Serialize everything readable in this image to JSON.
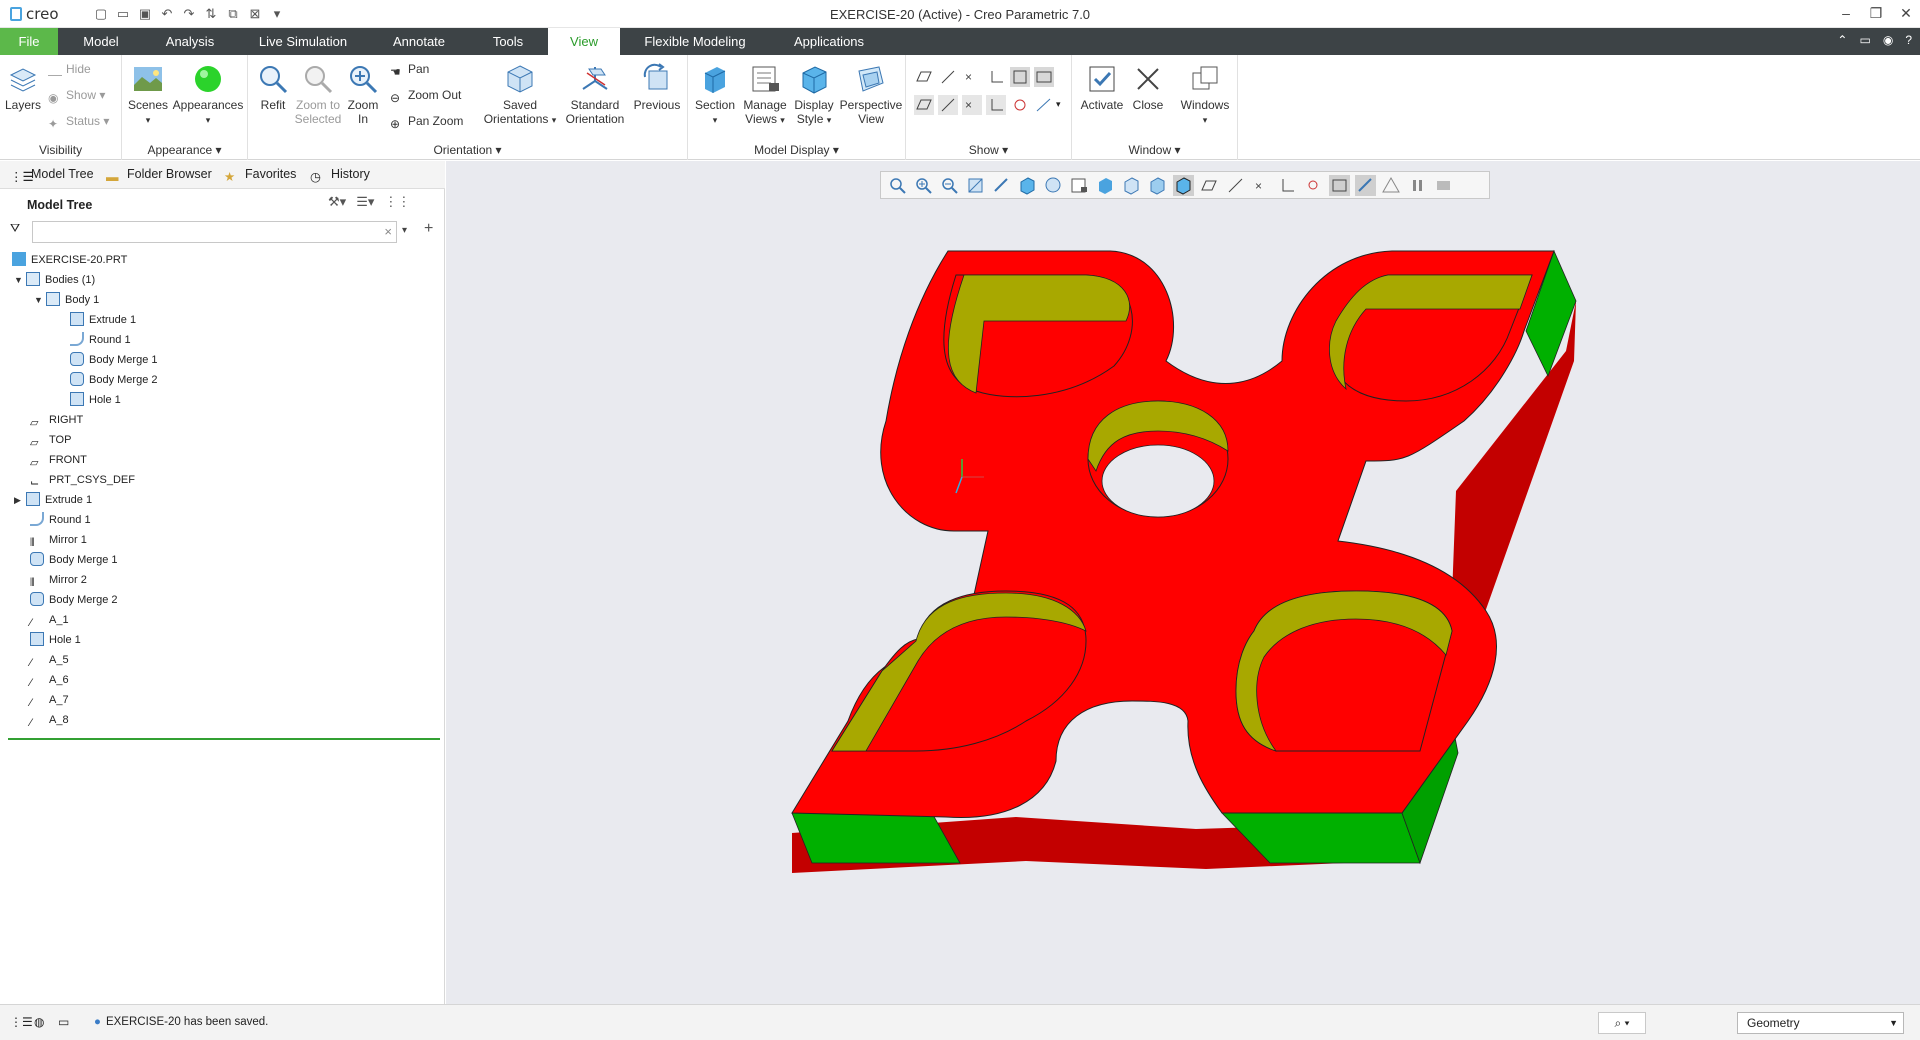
{
  "window": {
    "app_name": "creo",
    "title": "EXERCISE-20 (Active) - Creo Parametric 7.0"
  },
  "tabs": [
    {
      "label": "File"
    },
    {
      "label": "Model"
    },
    {
      "label": "Analysis"
    },
    {
      "label": "Live Simulation"
    },
    {
      "label": "Annotate"
    },
    {
      "label": "Tools"
    },
    {
      "label": "View"
    },
    {
      "label": "Flexible Modeling"
    },
    {
      "label": "Applications"
    }
  ],
  "ribbon": {
    "visibility": {
      "layers": "Layers",
      "hide": "Hide",
      "show": "Show",
      "status": "Status",
      "group": "Visibility"
    },
    "appearance": {
      "scenes": "Scenes",
      "appearances": "Appearances",
      "group": "Appearance"
    },
    "orientation": {
      "refit": "Refit",
      "zoom_to_selected_1": "Zoom to",
      "zoom_to_selected_2": "Selected",
      "zoom_in_1": "Zoom",
      "zoom_in_2": "In",
      "pan": "Pan",
      "zoom_out": "Zoom Out",
      "pan_zoom": "Pan Zoom",
      "saved_orientations_1": "Saved",
      "saved_orientations_2": "Orientations",
      "standard_orientation_1": "Standard",
      "standard_orientation_2": "Orientation",
      "previous": "Previous",
      "group": "Orientation"
    },
    "model_display": {
      "section": "Section",
      "manage_views_1": "Manage",
      "manage_views_2": "Views",
      "display_style_1": "Display",
      "display_style_2": "Style",
      "perspective_view_1": "Perspective",
      "perspective_view_2": "View",
      "group": "Model Display"
    },
    "show": {
      "group": "Show"
    },
    "window": {
      "activate": "Activate",
      "close": "Close",
      "windows": "Windows",
      "group": "Window"
    }
  },
  "navigator": {
    "tabs": [
      "Model Tree",
      "Folder Browser",
      "Favorites",
      "History"
    ],
    "tree_title": "Model Tree",
    "search_value": "",
    "items": [
      {
        "label": "EXERCISE-20.PRT"
      },
      {
        "label": "Bodies (1)"
      },
      {
        "label": "Body 1"
      },
      {
        "label": "Extrude 1"
      },
      {
        "label": "Round 1"
      },
      {
        "label": "Body Merge 1"
      },
      {
        "label": "Body Merge 2"
      },
      {
        "label": "Hole 1"
      },
      {
        "label": "RIGHT"
      },
      {
        "label": "TOP"
      },
      {
        "label": "FRONT"
      },
      {
        "label": "PRT_CSYS_DEF"
      },
      {
        "label": "Extrude 1"
      },
      {
        "label": "Round 1"
      },
      {
        "label": "Mirror 1"
      },
      {
        "label": "Body Merge 1"
      },
      {
        "label": "Mirror 2"
      },
      {
        "label": "Body Merge 2"
      },
      {
        "label": "A_1"
      },
      {
        "label": "Hole 1"
      },
      {
        "label": "A_5"
      },
      {
        "label": "A_6"
      },
      {
        "label": "A_7"
      },
      {
        "label": "A_8"
      }
    ]
  },
  "status": {
    "message": "EXERCISE-20 has been saved.",
    "filter_value": "Geometry"
  },
  "colors": {
    "part_face": "#ff0000",
    "hole_wall": "#a8a800",
    "side_faces": "#00b000",
    "background": "#e9eaef",
    "accent": "#5cb84a"
  }
}
